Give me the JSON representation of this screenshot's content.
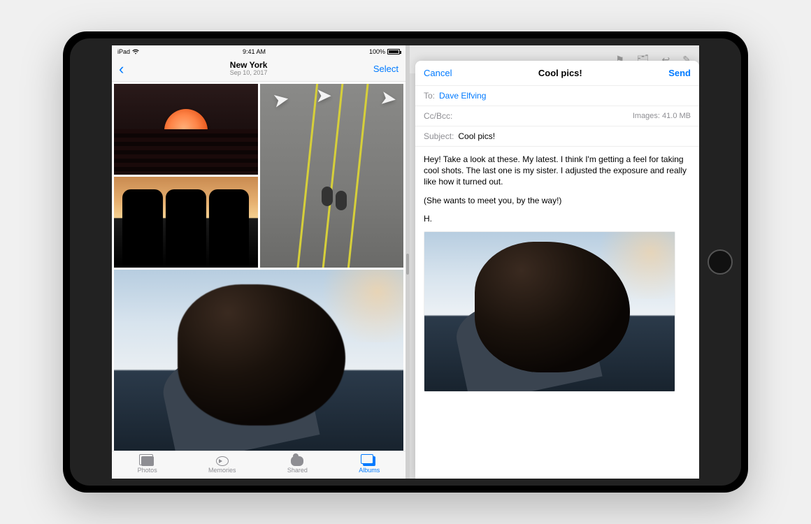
{
  "statusbar": {
    "device": "iPad",
    "time": "9:41 AM",
    "battery_pct": "100%"
  },
  "photos": {
    "back_icon": "chevron-left",
    "nav_title": "New York",
    "nav_subtitle": "Sep 10, 2017",
    "select_label": "Select",
    "tabs": [
      {
        "label": "Photos",
        "icon": "photos-icon",
        "active": false
      },
      {
        "label": "Memories",
        "icon": "memories-icon",
        "active": false
      },
      {
        "label": "Shared",
        "icon": "cloud-icon",
        "active": false
      },
      {
        "label": "Albums",
        "icon": "albums-icon",
        "active": true
      }
    ]
  },
  "mail_bg": {
    "toolbar_icons": [
      "flag-icon",
      "folder-icon",
      "reply-icon",
      "compose-icon"
    ]
  },
  "compose": {
    "cancel": "Cancel",
    "title": "Cool pics!",
    "send": "Send",
    "to_label": "To:",
    "to_value": "Dave Elfving",
    "ccbcc_label": "Cc/Bcc:",
    "images_size_label": "Images: 41.0 MB",
    "subject_label": "Subject:",
    "subject_value": "Cool pics!",
    "body_p1": "Hey! Take a look at these. My latest. I think I'm getting a feel for taking cool shots. The last one is my sister. I adjusted the exposure and really like how it turned out.",
    "body_p2": "(She wants to meet you, by the way!)",
    "body_sig": "H."
  },
  "colors": {
    "ios_blue": "#007aff",
    "secondary_gray": "#8e8e93"
  }
}
